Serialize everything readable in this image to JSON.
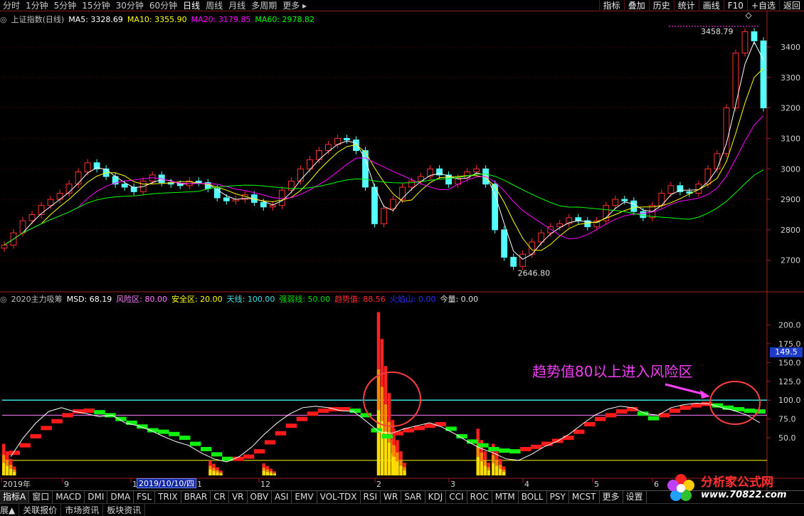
{
  "topbar": {
    "periods": [
      "分时",
      "1分钟",
      "5分钟",
      "15分钟",
      "30分钟",
      "60分钟",
      "日线",
      "周线",
      "月线",
      "多周期",
      "更多 ▸"
    ],
    "active_period": "日线",
    "tools": [
      "指标",
      "叠加",
      "历史",
      "统计",
      "画线",
      "F10",
      "+自选",
      "返回"
    ]
  },
  "main_info": {
    "title": "上证指数(日线)",
    "ma5": "MA5: 3328.69",
    "ma10": "MA10: 3355.90",
    "ma20": "MA20: 3179.85",
    "ma60": "MA60: 2978.82",
    "colors": {
      "title": "#c0c0c0",
      "ma5": "#ffffff",
      "ma10": "#ffff00",
      "ma20": "#ff00ff",
      "ma60": "#00ff00"
    }
  },
  "indicator_info": {
    "name": "2020主力吸筹",
    "msd": "MSD: 68.19",
    "risk": "风险区: 80.00",
    "safe": "安全区: 20.00",
    "sky": "天线: 100.00",
    "strong": "强弱线: 50.00",
    "trend": "趋势值: 88.56",
    "fire": "火焰山: 0.00",
    "vol": "今量: 0.00"
  },
  "chart_data": [
    {
      "type": "line",
      "name": "上证指数 K线",
      "y_ticks": [
        "3400",
        "3300",
        "3200",
        "3100",
        "3000",
        "2900",
        "2800",
        "2700"
      ],
      "ylim": [
        2620,
        3470
      ],
      "annotations": {
        "high": "3458.79",
        "low": "2646.80"
      },
      "close": [
        2750,
        2790,
        2830,
        2850,
        2880,
        2900,
        2920,
        2950,
        2990,
        3020,
        3000,
        2975,
        2950,
        2940,
        2925,
        2960,
        2980,
        2955,
        2950,
        2945,
        2960,
        2955,
        2935,
        2905,
        2895,
        2900,
        2915,
        2890,
        2875,
        2880,
        2930,
        2960,
        3000,
        3030,
        3060,
        3080,
        3100,
        3095,
        3060,
        2940,
        2820,
        2870,
        2900,
        2940,
        2960,
        2975,
        3000,
        2980,
        2950,
        2970,
        2990,
        3000,
        2950,
        2800,
        2710,
        2680,
        2720,
        2760,
        2790,
        2810,
        2820,
        2840,
        2830,
        2810,
        2830,
        2880,
        2900,
        2895,
        2860,
        2840,
        2880,
        2920,
        2945,
        2925,
        2920,
        2950,
        3000,
        3050,
        3200,
        3380,
        3450,
        3420,
        3200
      ]
    },
    {
      "type": "bar",
      "name": "2020主力吸筹",
      "y_ticks": [
        "200.0",
        "175.0",
        "150.0",
        "125.0",
        "100.0",
        "75.0",
        "50.0"
      ],
      "ylim": [
        0,
        225
      ],
      "cursor_value": "149.5",
      "levels": {
        "sky": 100,
        "risk": 80,
        "safe": 20
      },
      "trend": [
        30,
        40,
        52,
        63,
        72,
        80,
        85,
        86,
        84,
        80,
        75,
        70,
        65,
        60,
        58,
        55,
        50,
        42,
        35,
        28,
        22,
        22,
        25,
        32,
        44,
        56,
        66,
        75,
        82,
        86,
        88,
        88,
        86,
        80,
        60,
        52,
        56,
        60,
        63,
        66,
        68,
        62,
        52,
        45,
        40,
        35,
        33,
        32,
        35,
        38,
        42,
        46,
        50,
        58,
        68,
        75,
        80,
        85,
        88,
        82,
        76,
        80,
        86,
        90,
        93,
        95,
        93,
        90,
        88,
        86,
        85
      ],
      "msd": [
        25,
        50,
        70,
        85,
        90,
        85,
        82,
        78,
        80,
        70,
        66,
        60,
        52,
        45,
        40,
        30,
        22,
        18,
        25,
        38,
        55,
        70,
        82,
        90,
        92,
        90,
        86,
        85,
        72,
        58,
        56,
        62,
        66,
        70,
        64,
        55,
        45,
        36,
        30,
        22,
        20,
        28,
        38,
        45,
        55,
        68,
        80,
        88,
        92,
        90,
        82,
        80,
        90,
        94,
        96,
        95,
        90,
        86,
        80,
        70
      ],
      "fire": [
        {
          "x": 0.0,
          "v": 40
        },
        {
          "x": 0.27,
          "v": 18
        },
        {
          "x": 0.34,
          "v": 14
        },
        {
          "x": 0.49,
          "v": 215
        },
        {
          "x": 0.51,
          "v": 60
        },
        {
          "x": 0.62,
          "v": 60
        },
        {
          "x": 0.64,
          "v": 40
        }
      ]
    }
  ],
  "x_axis": {
    "labels": [
      "2019年",
      "9",
      "10",
      "11",
      "12",
      "2",
      "3",
      "4",
      "5",
      "6"
    ],
    "cursor_date": "2019/10/10/四"
  },
  "annotation": "趋势值80以上进入风险区",
  "tabs": [
    "指标A",
    "窗口",
    "MACD",
    "DMI",
    "DMA",
    "FSL",
    "TRIX",
    "BRAR",
    "CR",
    "VR",
    "OBV",
    "ASI",
    "EMV",
    "VOL-TDX",
    "RSI",
    "WR",
    "SAR",
    "KDJ",
    "CCI",
    "ROC",
    "MTM",
    "BOLL",
    "PSY",
    "MCST",
    "更多",
    "设置"
  ],
  "active_tab": "指标A",
  "status_items": [
    "展▲",
    "关联报价",
    "市场资讯",
    "板块资讯"
  ],
  "watermark": {
    "line1": "分析家公式网",
    "line2": "www.70822.com"
  }
}
